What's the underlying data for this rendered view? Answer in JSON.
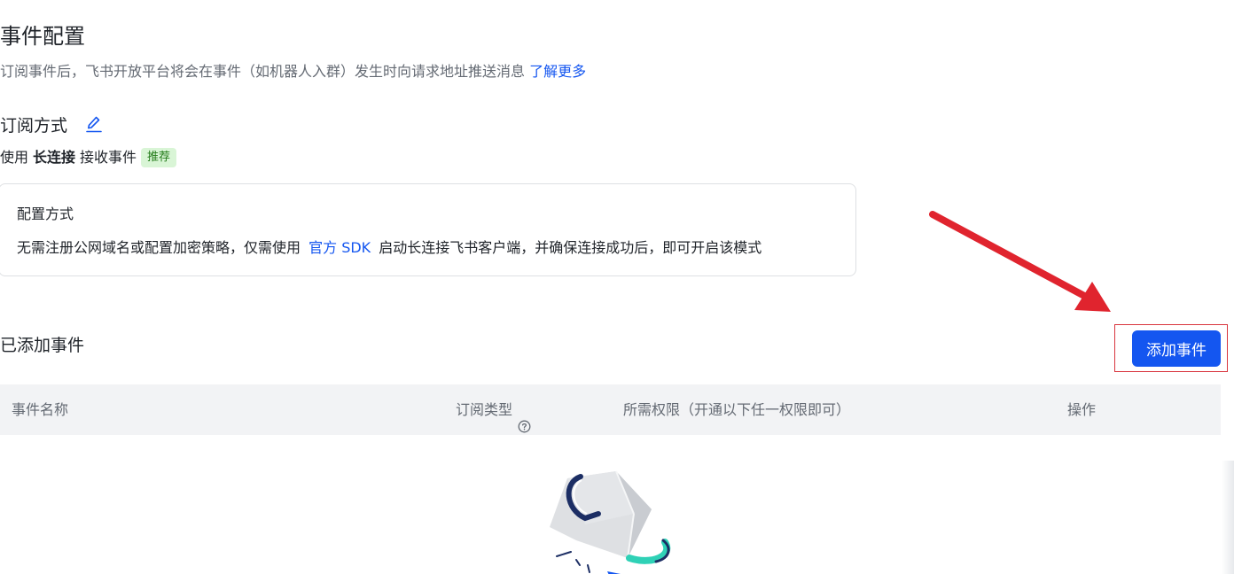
{
  "header": {
    "title": "事件配置",
    "description": "订阅事件后，飞书开放平台将会在事件（如机器人入群）发生时向请求地址推送消息",
    "learn_more": "了解更多"
  },
  "subscription": {
    "heading": "订阅方式",
    "edit_icon": "edit-pencil-icon",
    "method_prefix": "使用",
    "method_bold": "长连接",
    "method_suffix": "接收事件",
    "badge": "推荐"
  },
  "config_card": {
    "title": "配置方式",
    "body_prefix": "无需注册公网域名或配置加密策略，仅需使用",
    "body_link": "官方 SDK",
    "body_suffix": "启动长连接飞书客户端，并确保连接成功后，即可开启该模式"
  },
  "events": {
    "title": "已添加事件",
    "add_button": "添加事件",
    "columns": [
      "事件名称",
      "订阅类型",
      "所需权限（开通以下任一权限即可）",
      "操作"
    ],
    "rows": []
  },
  "colors": {
    "accent": "#1456f0",
    "annotation_red": "#e0242e",
    "badge_bg": "#d9f5d6",
    "badge_text": "#237b19"
  },
  "icons": {
    "help": "question-circle-icon",
    "empty_state": "empty-box-illustration"
  }
}
